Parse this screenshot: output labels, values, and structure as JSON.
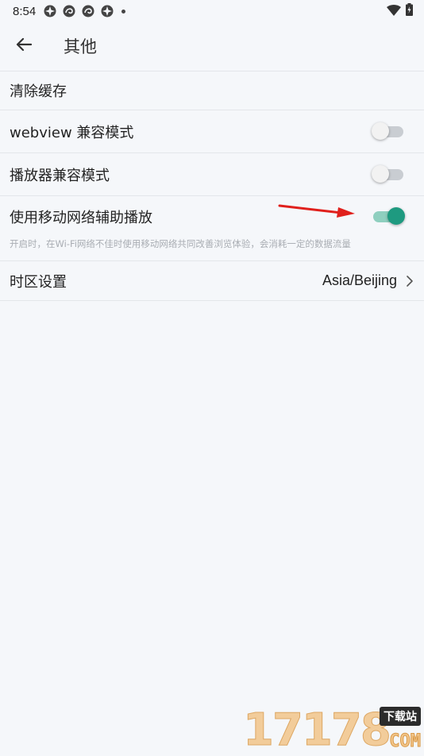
{
  "status_bar": {
    "time": "8:54"
  },
  "header": {
    "title": "其他"
  },
  "settings": {
    "clear_cache": {
      "label": "清除缓存"
    },
    "webview_compat": {
      "label": "webview 兼容模式",
      "enabled": false
    },
    "player_compat": {
      "label": "播放器兼容模式",
      "enabled": false
    },
    "mobile_assist": {
      "label": "使用移动网络辅助播放",
      "description": "开启时，在Wi-Fi网络不佳时使用移动网络共同改善浏览体验，会消耗一定的数据流量",
      "enabled": true
    },
    "timezone": {
      "label": "时区设置",
      "value": "Asia/Beijing"
    }
  },
  "watermark": {
    "number": "17178",
    "badge": "下载站",
    "suffix": "COM"
  },
  "colors": {
    "accent": "#1e9a80",
    "accent_track": "#8fcfbf",
    "background": "#f5f7fa",
    "annotation_arrow": "#e0201c"
  }
}
